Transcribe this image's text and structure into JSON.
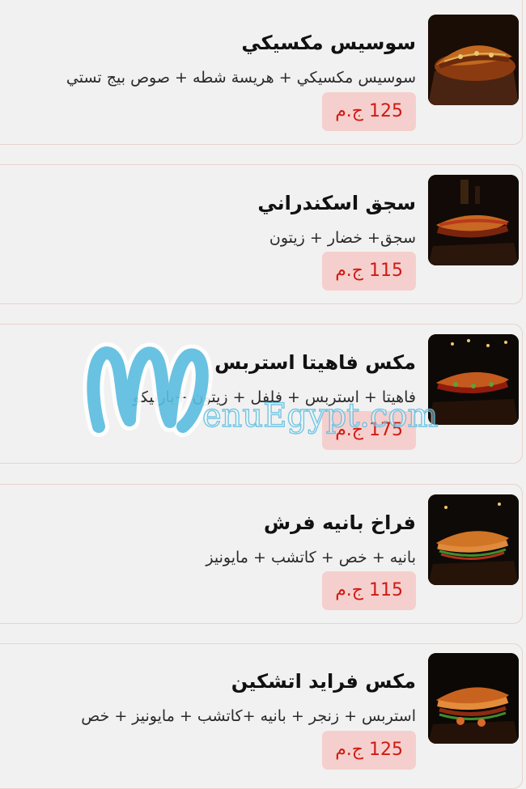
{
  "menu": {
    "items": [
      {
        "title": "سوسيس مكسيكي",
        "description": "سوسيس مكسيكي + هريسة شطه + صوص بيج تستي",
        "price": "125 ج.م",
        "image_icon": "sandwich-image"
      },
      {
        "title": "سجق اسكندراني",
        "description": "سجق+ خضار + زيتون",
        "price": "115 ج.م",
        "image_icon": "sandwich-image"
      },
      {
        "title": "مكس فاهيتا استربس",
        "description": "فاهيتا + استربس + فلفل + زيتون +باربيكو",
        "price": "175 ج.م",
        "image_icon": "sandwich-image"
      },
      {
        "title": "فراخ بانيه فرش",
        "description": "بانيه + خص + كاتشب + مايونيز",
        "price": "115 ج.م",
        "image_icon": "sandwich-image"
      },
      {
        "title": "مكس فرايد اتشكين",
        "description": "استربس + زنجر + بانيه +كاتشب + مايونيز + خص",
        "price": "125 ج.م",
        "image_icon": "sandwich-image"
      }
    ]
  },
  "watermark": {
    "text": "enuEgypt.com",
    "logo_icon": "menuegypt-logo-icon"
  },
  "colors": {
    "price_text": "#cf1a12",
    "price_bg": "#f5cfcd",
    "card_border": "#e7d3cc",
    "watermark": "#5bbde0"
  }
}
